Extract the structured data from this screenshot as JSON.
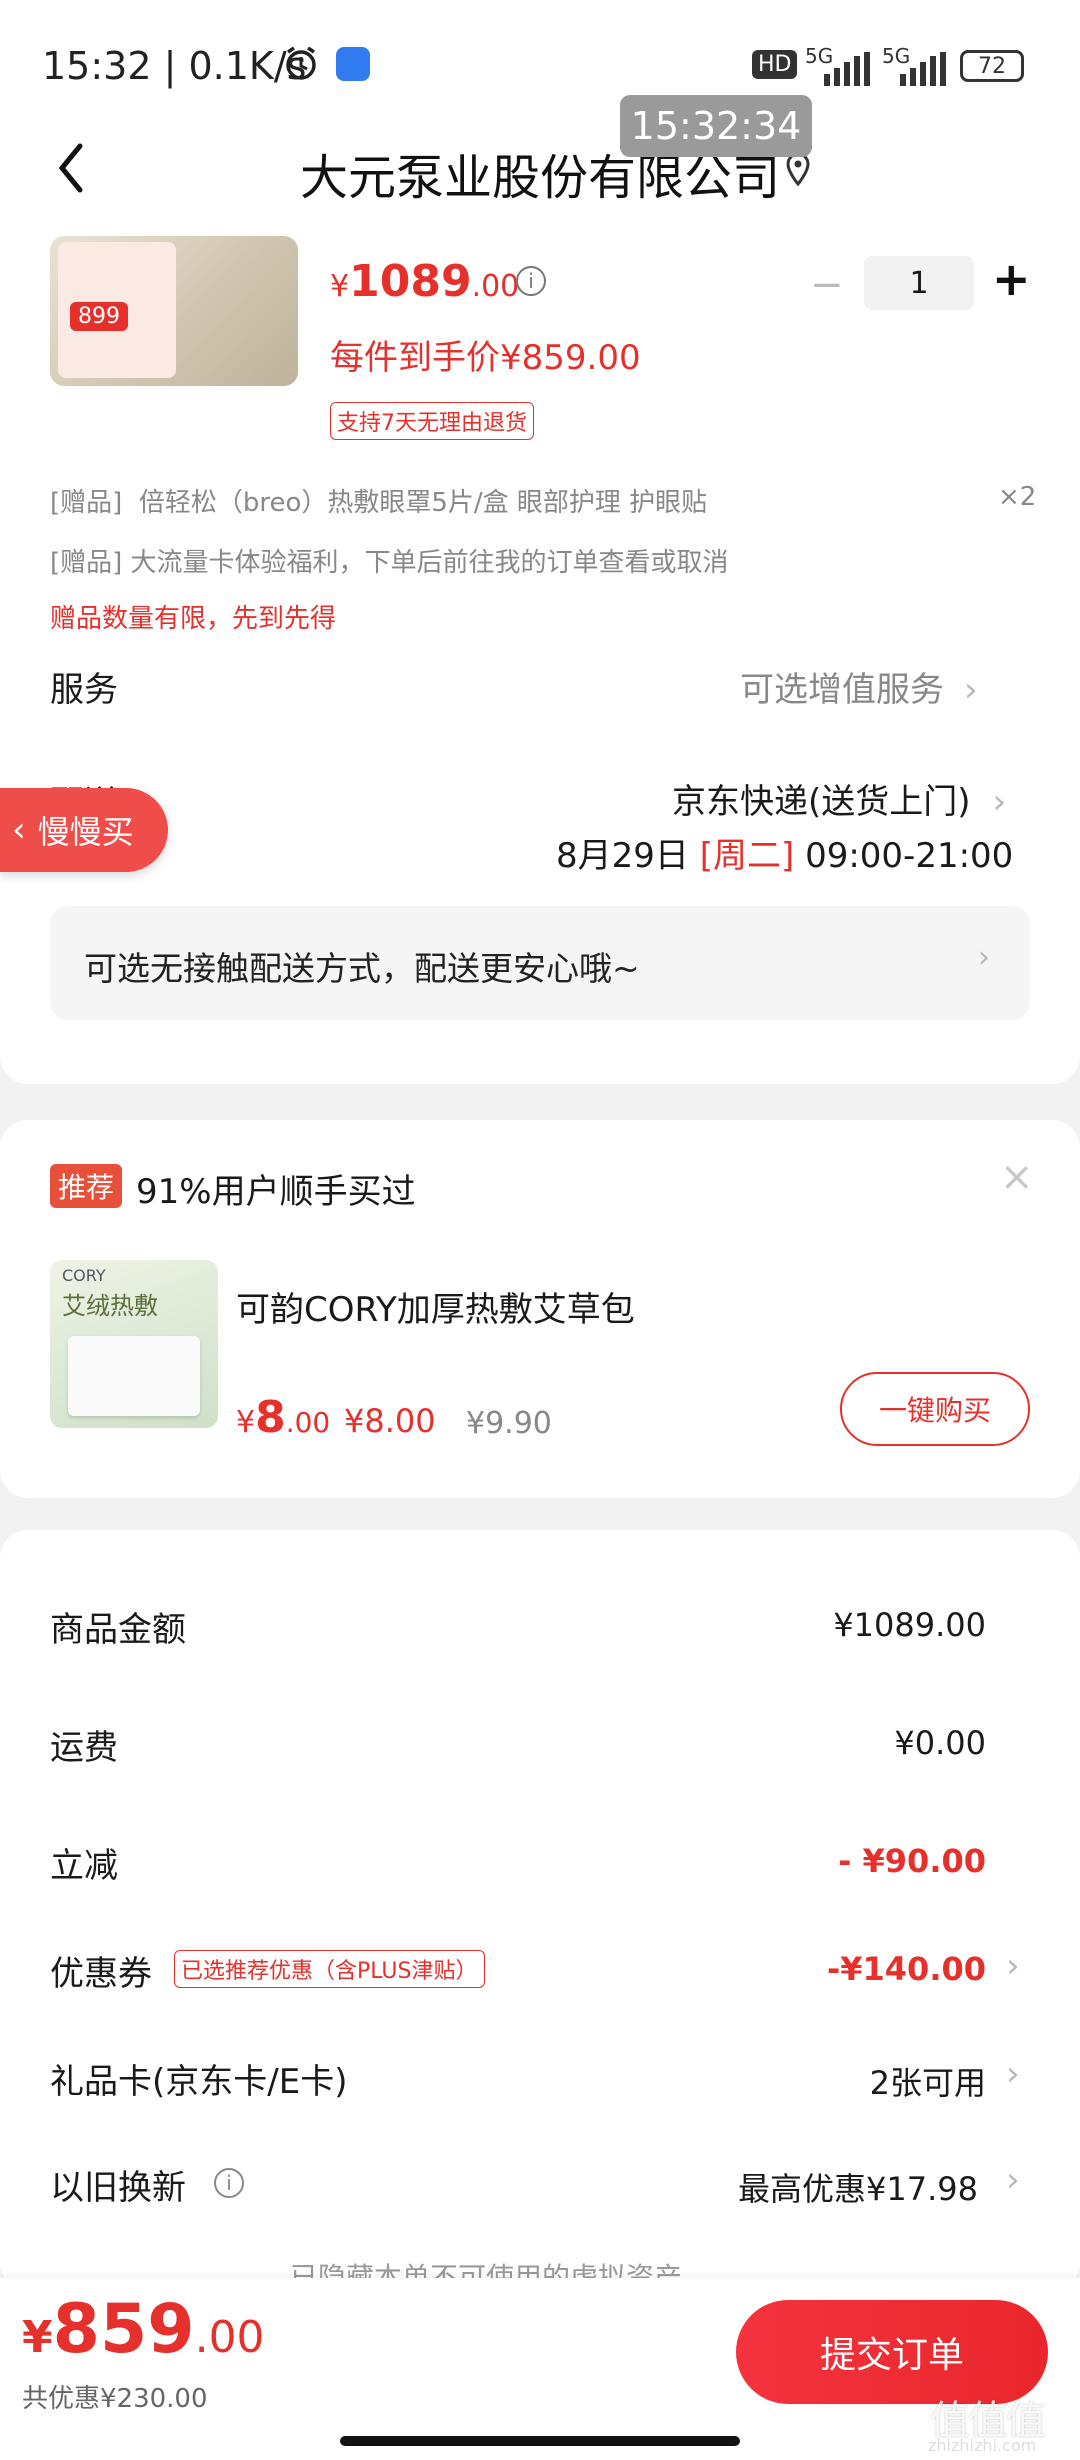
{
  "status_bar": {
    "time_speed": "15:32 | 0.1K/s",
    "battery": "72",
    "net1": "5G",
    "net2": "5G",
    "hd": "HD"
  },
  "overlay_time": "15:32:34",
  "header": {
    "title": "大元泵业股份有限公司"
  },
  "product": {
    "thumb_price": "899",
    "currency": "¥",
    "price_int": "1089",
    "price_dec": ".00",
    "per_item_price": "每件到手价¥859.00",
    "return_tag": "支持7天无理由退货",
    "quantity": "1",
    "minus": "−",
    "plus": "+"
  },
  "gifts": {
    "gift1_prefix": "[赠品]",
    "gift1_text": "倍轻松（breo）热敷眼罩5片/盒 眼部护理 护眼贴",
    "gift1_count": "×2",
    "gift2_text": "[赠品] 大流量卡体验福利，下单后前往我的订单查看或取消",
    "gift_notice": "赠品数量有限，先到先得"
  },
  "service": {
    "label": "服务",
    "value": "可选增值服务"
  },
  "delivery": {
    "label": "配送",
    "carrier": "京东快递(送货上门)",
    "date": "8月29日",
    "weekday": "[周二]",
    "time": "09:00-21:00",
    "contactless": "可选无接触配送方式，配送更安心哦~"
  },
  "slow_buy": {
    "label": "慢慢买"
  },
  "recommend": {
    "badge": "推荐",
    "headline": "91%用户顺手买过",
    "close": "×",
    "product_name": "可韵CORY加厚热敷艾草包",
    "thumb_brand": "CORY",
    "thumb_title": "艾绒热敷",
    "currency": "¥",
    "price_int": "8",
    "price_dec": ".00",
    "price2": "¥8.00",
    "price_orig": "¥9.90",
    "buy_button": "一键购买"
  },
  "summary": {
    "rows": [
      {
        "label": "商品金额",
        "value": "¥1089.00"
      },
      {
        "label": "运费",
        "value": "¥0.00"
      },
      {
        "label": "立减",
        "value": "- ¥90.00"
      },
      {
        "label": "优惠券",
        "tag": "已选推荐优惠（含PLUS津贴）",
        "value": "-¥140.00"
      },
      {
        "label": "礼品卡(京东卡/E卡)",
        "value": "2张可用"
      },
      {
        "label": "以旧换新",
        "value": "最高优惠¥17.98"
      }
    ],
    "hidden_note": "已隐藏本单不可使用的虚拟资产"
  },
  "bottom_bar": {
    "currency": "¥",
    "total_int": "859",
    "total_dec": ".00",
    "savings": "共优惠¥230.00",
    "submit": "提交订单",
    "watermark": "值值值",
    "watermark_url": "zhizhizhi.com"
  },
  "colors": {
    "accent": "#e5302c",
    "background": "#f2f2f2"
  }
}
